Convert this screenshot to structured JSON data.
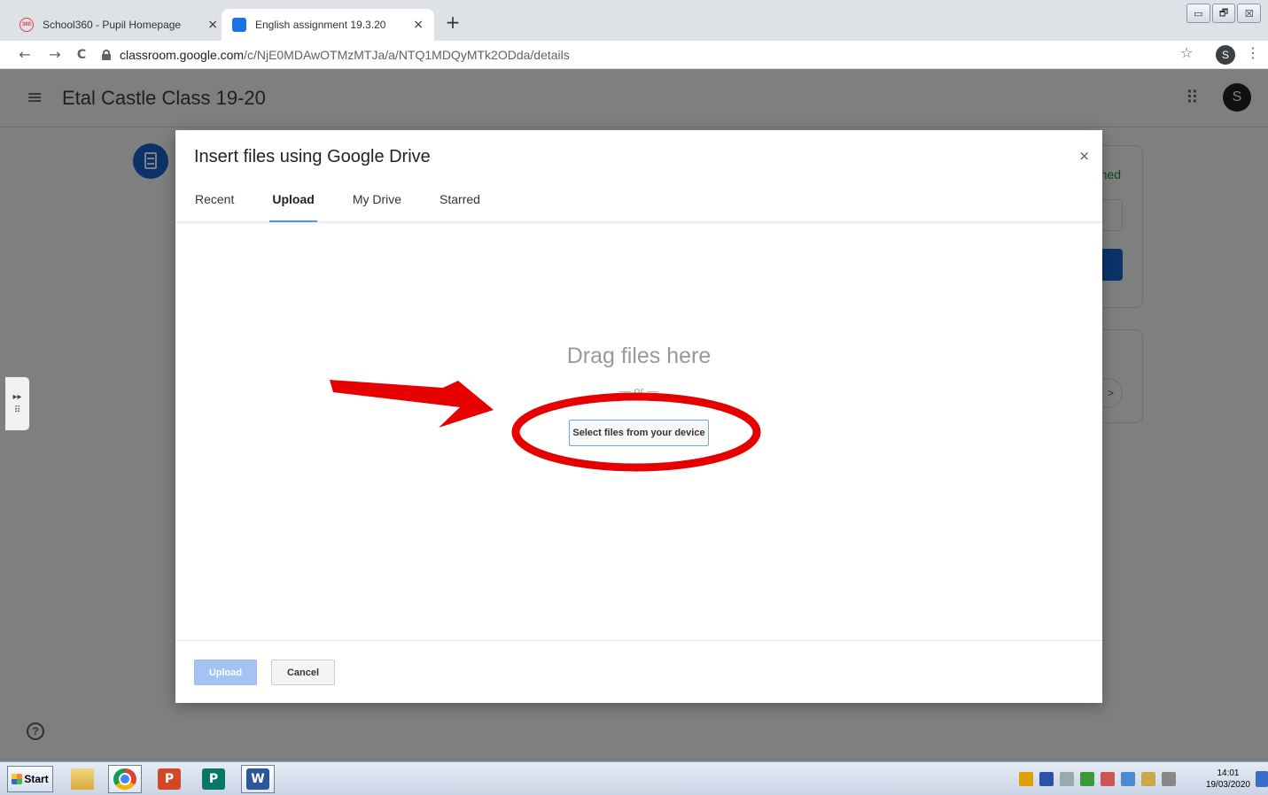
{
  "browser": {
    "tabs": [
      {
        "title": "School360 - Pupil Homepage",
        "favicon": "360",
        "close": "×",
        "active": false
      },
      {
        "title": "English assignment 19.3.20",
        "favicon": "👤",
        "close": "×",
        "active": true
      }
    ],
    "new_tab": "+",
    "window_controls": {
      "minimize": "▭",
      "maximize": "🗗",
      "close": "☒"
    },
    "url": {
      "host": "classroom.google.com",
      "path": "/c/NjE0MDAwOTMzMTJa/a/NTQ1MDQyMTk2ODda/details"
    },
    "profile_initial": "S",
    "nav": {
      "back": "←",
      "forward": "→",
      "reload": "C",
      "star": "☆",
      "menu": "⋮"
    }
  },
  "page": {
    "class_title": "Etal Castle Class 19-20",
    "account_initial": "S",
    "hamburger": "≡",
    "apps": "⠿",
    "card_status": "ned",
    "card_send": ">",
    "help": "?"
  },
  "side_handle": {
    "arrows": "▸▸",
    "grid": "⠿"
  },
  "dialog": {
    "title": "Insert files using Google Drive",
    "close": "×",
    "tabs": [
      {
        "label": "Recent",
        "selected": false
      },
      {
        "label": "Upload",
        "selected": true
      },
      {
        "label": "My Drive",
        "selected": false
      },
      {
        "label": "Starred",
        "selected": false
      }
    ],
    "drag_text": "Drag files here",
    "or_text": "— or —",
    "select_button": "Select files from your device",
    "upload_button": "Upload",
    "cancel_button": "Cancel"
  },
  "annotation": {
    "color": "#e60000"
  },
  "taskbar": {
    "start_label": "Start",
    "apps": [
      {
        "name": "explorer",
        "glyph": ""
      },
      {
        "name": "chrome",
        "glyph": ""
      },
      {
        "name": "powerpoint",
        "glyph": "P"
      },
      {
        "name": "publisher",
        "glyph": "P"
      },
      {
        "name": "word",
        "glyph": "W"
      }
    ],
    "clock_time": "14:01",
    "clock_date": "19/03/2020"
  }
}
